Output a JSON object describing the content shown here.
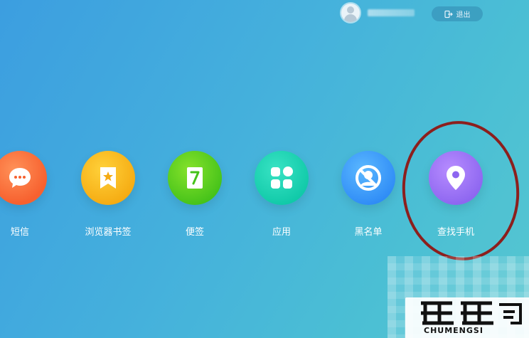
{
  "header": {
    "logout_label": "退出"
  },
  "apps": [
    {
      "label": "短信",
      "icon": "chat-bubble-icon",
      "color": "#f7612f"
    },
    {
      "label": "浏览器书签",
      "icon": "bookmark-star-icon",
      "color": "#f5ab12"
    },
    {
      "label": "便签",
      "icon": "note-pen-icon",
      "color": "#45c21a"
    },
    {
      "label": "应用",
      "icon": "apps-grid-icon",
      "color": "#10c9a8"
    },
    {
      "label": "黑名单",
      "icon": "blocked-user-icon",
      "color": "#2f8cf6"
    },
    {
      "label": "查找手机",
      "icon": "location-pin-icon",
      "color": "#8d66f0"
    }
  ],
  "highlight_color": "#8c1f1d",
  "watermark": {
    "text": "CHUMENGSI"
  }
}
